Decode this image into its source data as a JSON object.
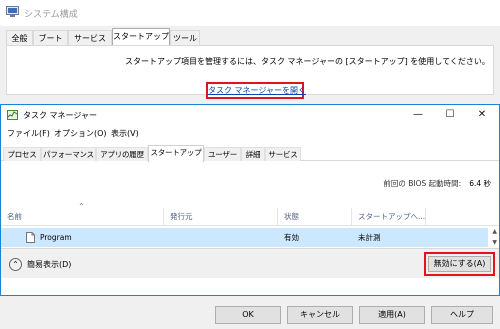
{
  "system_config": {
    "title": "システム構成",
    "tabs": [
      "全般",
      "ブート",
      "サービス",
      "スタートアップ",
      "ツール"
    ],
    "active_tab": 3,
    "message": "スタートアップ項目を管理するには、タスク マネージャーの [スタートアップ] を使用してください。",
    "open_task_manager_link": "タスク マネージャーを開く",
    "buttons": {
      "ok": "OK",
      "cancel": "キャンセル",
      "apply": "適用(A)",
      "help": "ヘルプ"
    }
  },
  "task_manager": {
    "title": "タスク マネージャー",
    "window_buttons": {
      "minimize": "—",
      "maximize": "☐",
      "close": "✕"
    },
    "menu": [
      "ファイル(F)",
      "オプション(O)",
      "表示(V)"
    ],
    "tabs": [
      "プロセス",
      "パフォーマンス",
      "アプリの履歴",
      "スタートアップ",
      "ユーザー",
      "詳細",
      "サービス"
    ],
    "active_tab": 3,
    "bios_label": "前回の BIOS 起動時間:",
    "bios_value": "6.4 秒",
    "columns": [
      "名前",
      "発行元",
      "状態",
      "スタートアップへ..."
    ],
    "rows": [
      {
        "name": "Program",
        "publisher": "",
        "status": "有効",
        "impact": "未計測"
      }
    ],
    "fewer_details": "簡易表示(D)",
    "disable_button": "無効にする(A)"
  },
  "colors": {
    "highlight_border": "#e0141e",
    "selected_row": "#cce8ff",
    "window_border": "#1883d7",
    "link": "#0645ad"
  }
}
